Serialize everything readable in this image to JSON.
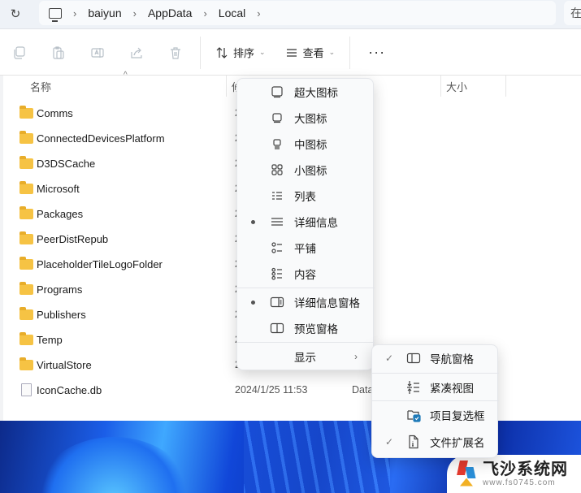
{
  "address_bar": {
    "refresh_icon": "refresh-icon",
    "pc_icon": "computer-icon",
    "breadcrumbs": [
      "baiyun",
      "AppData",
      "Local"
    ],
    "search_hint": "在"
  },
  "toolbar": {
    "icons": [
      "copy-icon",
      "paste-icon",
      "rename-icon",
      "share-icon",
      "delete-icon"
    ],
    "sort_label": "排序",
    "view_label": "查看",
    "more_label": "···"
  },
  "list": {
    "columns": {
      "name": "名称",
      "date": "修",
      "size": "大小"
    },
    "rows": [
      {
        "name": "Comms",
        "kind": "folder",
        "date": "2"
      },
      {
        "name": "ConnectedDevicesPlatform",
        "kind": "folder",
        "date": "2"
      },
      {
        "name": "D3DSCache",
        "kind": "folder",
        "date": "2"
      },
      {
        "name": "Microsoft",
        "kind": "folder",
        "date": "2"
      },
      {
        "name": "Packages",
        "kind": "folder",
        "date": "2"
      },
      {
        "name": "PeerDistRepub",
        "kind": "folder",
        "date": "2"
      },
      {
        "name": "PlaceholderTileLogoFolder",
        "kind": "folder",
        "date": "2"
      },
      {
        "name": "Programs",
        "kind": "folder",
        "date": "2"
      },
      {
        "name": "Publishers",
        "kind": "folder",
        "date": "2"
      },
      {
        "name": "Temp",
        "kind": "folder",
        "date": "2"
      },
      {
        "name": "VirtualStore",
        "kind": "folder",
        "date": "2"
      },
      {
        "name": "IconCache.db",
        "kind": "file",
        "date": "2024/1/25 11:53",
        "type": "Data"
      }
    ]
  },
  "view_menu": {
    "items": [
      {
        "label": "超大图标",
        "icon": "extra-large-icons-icon",
        "selected": false
      },
      {
        "label": "大图标",
        "icon": "large-icons-icon",
        "selected": false
      },
      {
        "label": "中图标",
        "icon": "medium-icons-icon",
        "selected": false
      },
      {
        "label": "小图标",
        "icon": "small-icons-icon",
        "selected": false
      },
      {
        "label": "列表",
        "icon": "list-icon",
        "selected": false
      },
      {
        "label": "详细信息",
        "icon": "details-icon",
        "selected": true
      },
      {
        "label": "平铺",
        "icon": "tiles-icon",
        "selected": false
      },
      {
        "label": "内容",
        "icon": "content-icon",
        "selected": false
      },
      {
        "label": "详细信息窗格",
        "icon": "details-pane-icon",
        "selected": true
      },
      {
        "label": "预览窗格",
        "icon": "preview-pane-icon",
        "selected": false
      },
      {
        "label": "显示",
        "icon": "",
        "has_submenu": true
      }
    ]
  },
  "show_submenu": {
    "items": [
      {
        "label": "导航窗格",
        "icon": "navigation-pane-icon",
        "checked": true
      },
      {
        "label": "紧凑视图",
        "icon": "compact-view-icon",
        "checked": false
      },
      {
        "label": "项目复选框",
        "icon": "item-checkbox-icon",
        "checked": false
      },
      {
        "label": "文件扩展名",
        "icon": "file-extension-icon",
        "checked": true
      }
    ]
  },
  "watermark": {
    "title": "飞沙系统网",
    "url": "www.fs0745.com"
  }
}
